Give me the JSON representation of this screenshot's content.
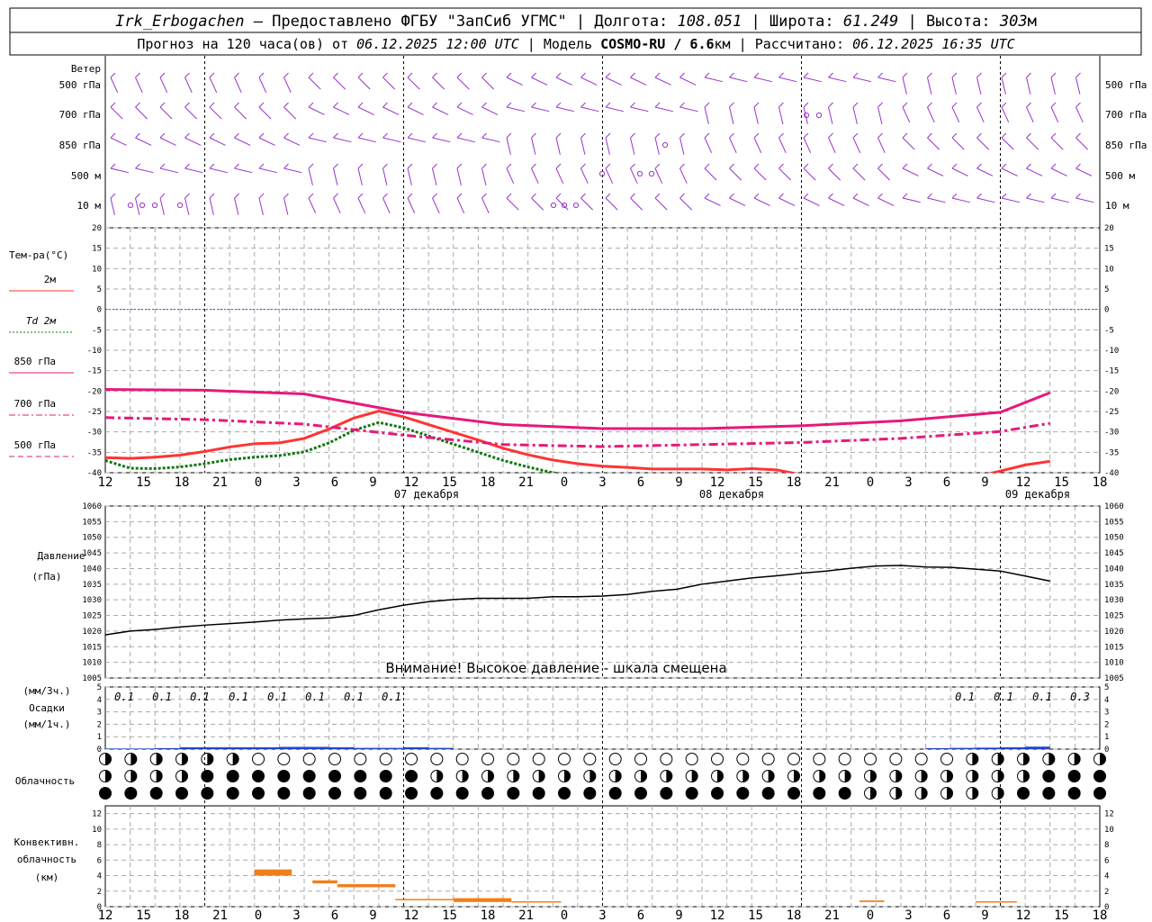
{
  "header": {
    "station": "Irk_Erbogachen",
    "provider": " – Предоставлено ФГБУ \"ЗапСиб УГМС\"",
    "lon_label": "Долгота:",
    "lon": "108.051",
    "lat_label": "Широта:",
    "lat": "61.249",
    "alt_label": "Высота:",
    "alt": "303",
    "alt_unit": "м",
    "forecast_prefix": "Прогноз на 120 часа(ов) от",
    "forecast_start": "06.12.2025 12:00 UTC",
    "model_label": "Модель",
    "model": "COSMO-RU / 6.6",
    "model_unit": "км",
    "calc_label": "Рассчитано:",
    "calc_time": "06.12.2025 16:35 UTC"
  },
  "wind_panel": {
    "title": "Ветер",
    "levels": [
      "500 гПа",
      "700 гПа",
      "850 гПа",
      "500 м",
      "10  м"
    ],
    "color": "#9933cc"
  },
  "temp_panel": {
    "title": "Тем-ра(°C)",
    "legend": [
      {
        "label": "2м",
        "color": "#ff3333",
        "style": "solid"
      },
      {
        "label": "Td  2м",
        "color": "#117711",
        "style": "dotted"
      },
      {
        "label": "850 гПа",
        "color": "#e6197a",
        "style": "solid"
      },
      {
        "label": "700 гПа",
        "color": "#e6197a",
        "style": "dashdot"
      },
      {
        "label": "500 гПа",
        "color": "#e6197a",
        "style": "dashed"
      }
    ]
  },
  "pressure_panel": {
    "title1": "Давление",
    "title2": "(гПа)",
    "warning": "Внимание! Высокое давление - шкала смещена"
  },
  "precip_panel": {
    "title1": "(мм/3ч.)",
    "title2": "Осадки",
    "title3": "(мм/1ч.)",
    "labels": [
      "0.1",
      "0.1",
      "0.1",
      "0.1",
      "0.1",
      "0.1",
      "0.1",
      "0.1",
      "0.1",
      "0.1",
      "0.1",
      "0.3"
    ]
  },
  "cloud_panel": {
    "title": "Облачность"
  },
  "conv_panel": {
    "title1": "Конвективн.",
    "title2": "облачность",
    "title3": "(км)",
    "color": "#f07f1d"
  },
  "x_axis": {
    "hour_labels": [
      "12",
      "15",
      "18",
      "21",
      "0",
      "3",
      "6",
      "9",
      "12",
      "15",
      "18",
      "21",
      "0",
      "3",
      "6",
      "9",
      "12",
      "15",
      "18",
      "21",
      "0",
      "3",
      "6",
      "9",
      "12",
      "15",
      "18"
    ],
    "days": [
      "07 декабря",
      "08 декабря",
      "09 декабря"
    ]
  },
  "chart_data": [
    {
      "type": "line",
      "title": "Тем-ра(°C)",
      "x_unit": "hours from 06.12.2025 12:00 UTC",
      "ylim": [
        -40,
        20
      ],
      "yticks": [
        20,
        15,
        10,
        5,
        0,
        -5,
        -10,
        -15,
        -20,
        -25,
        -30,
        -35,
        -40
      ],
      "series": [
        {
          "name": "2м",
          "x": [
            0,
            3,
            6,
            9,
            12,
            15,
            18,
            21,
            24,
            27,
            30,
            33,
            36,
            39,
            42,
            45,
            48,
            51,
            54,
            57,
            60,
            63,
            66,
            69,
            72,
            75,
            78,
            81,
            84,
            87,
            90,
            93,
            96,
            99,
            102,
            105,
            108,
            111,
            114
          ],
          "values": [
            -36.3,
            -36.5,
            -36.2,
            -35.7,
            -34.8,
            -33.7,
            -32.9,
            -32.7,
            -31.6,
            -29.3,
            -26.6,
            -24.9,
            -26.3,
            -28.2,
            -30.1,
            -32,
            -34,
            -35.6,
            -36.9,
            -37.8,
            -38.4,
            -38.7,
            -39.1,
            -39.1,
            -39.1,
            -39.3,
            -39,
            -39.3,
            -40.5,
            -41,
            -41.3,
            -41.5,
            -41.5,
            -41.6,
            -41.5,
            -41,
            -39.6,
            -38.1,
            -37.2
          ]
        },
        {
          "name": "Td  2м",
          "x": [
            0,
            3,
            6,
            9,
            12,
            15,
            18,
            21,
            24,
            27,
            30,
            33,
            36,
            39,
            42,
            45,
            48,
            51,
            54,
            57,
            60,
            63,
            66,
            69,
            72,
            75,
            78,
            81,
            84,
            87,
            90,
            93,
            96,
            99,
            102,
            105,
            108,
            111,
            114
          ],
          "values": [
            -37,
            -38.9,
            -39,
            -38.6,
            -37.8,
            -36.8,
            -36.2,
            -35.8,
            -34.9,
            -32.7,
            -29.6,
            -27.7,
            -29,
            -31,
            -33,
            -35,
            -37,
            -38.6,
            -40,
            -41,
            -41.6,
            -42,
            -42.4,
            -42.4,
            -42.6,
            -42.7,
            -42.4,
            -42.7,
            -43.5,
            -44,
            -44.3,
            -44.5,
            -44.6,
            -44.7,
            -44.7,
            -44.4,
            -43.3,
            -41.8,
            -40.6
          ]
        },
        {
          "name": "850 гПа",
          "x": [
            0,
            12,
            24,
            36,
            48,
            60,
            72,
            84,
            96,
            108,
            114
          ],
          "values": [
            -19.6,
            -19.8,
            -20.7,
            -25.2,
            -28.2,
            -29.2,
            -29.2,
            -28.5,
            -27.3,
            -25.2,
            -20.4
          ]
        },
        {
          "name": "700 гПа",
          "x": [
            0,
            12,
            24,
            36,
            48,
            60,
            72,
            84,
            96,
            108,
            114
          ],
          "values": [
            -26.5,
            -27,
            -28.1,
            -30.8,
            -33.1,
            -33.6,
            -33.1,
            -32.6,
            -31.6,
            -29.9,
            -27.9
          ]
        },
        {
          "name": "500 гПа",
          "x": [
            0,
            12,
            24,
            36,
            48,
            60,
            72,
            84,
            96,
            108,
            114
          ],
          "values": [
            -44,
            -44.5,
            -45.2,
            -46.5,
            -47.2,
            -47.5,
            -47.7,
            -47.5,
            -47.3,
            -47,
            -46.5
          ]
        }
      ]
    },
    {
      "type": "line",
      "title": "Давление",
      "ylabel": "(гПа)",
      "ylim": [
        1005,
        1060
      ],
      "yticks": [
        1060,
        1055,
        1050,
        1045,
        1040,
        1035,
        1030,
        1025,
        1020,
        1015,
        1010,
        1005
      ],
      "x": [
        0,
        3,
        6,
        9,
        12,
        15,
        18,
        21,
        24,
        27,
        30,
        33,
        36,
        39,
        42,
        45,
        48,
        51,
        54,
        57,
        60,
        63,
        66,
        69,
        72,
        75,
        78,
        81,
        84,
        87,
        90,
        93,
        96,
        99,
        102,
        105,
        108,
        111,
        114
      ],
      "values": [
        1018.8,
        1020,
        1020.5,
        1021.3,
        1021.9,
        1022.4,
        1022.9,
        1023.5,
        1023.9,
        1024.2,
        1025,
        1026.8,
        1028.3,
        1029.4,
        1030.1,
        1030.5,
        1030.5,
        1030.5,
        1031,
        1031,
        1031.2,
        1031.7,
        1032.7,
        1033.4,
        1035,
        1036,
        1037,
        1037.7,
        1038.5,
        1039.2,
        1040.1,
        1040.8,
        1041,
        1040.5,
        1040.4,
        1039.8,
        1039.2,
        1037.6,
        1036
      ]
    },
    {
      "type": "bar",
      "title": "Осадки",
      "ylabel": "(мм/1ч.)",
      "ylim": [
        0,
        5
      ],
      "yticks": [
        5,
        4,
        3,
        2,
        1,
        0
      ],
      "x": [
        3,
        6,
        9,
        12,
        15,
        18,
        21,
        24,
        27,
        30,
        33,
        36,
        39,
        42,
        45,
        48,
        51,
        54,
        57,
        60,
        63,
        66,
        69,
        72,
        75,
        78,
        81,
        84,
        87,
        90,
        93,
        96,
        99,
        102,
        105,
        108,
        111,
        114
      ],
      "values": [
        0.05,
        0.05,
        0.08,
        0.15,
        0.15,
        0.15,
        0.15,
        0.18,
        0.18,
        0.15,
        0.1,
        0.1,
        0.15,
        0.1,
        0,
        0,
        0,
        0,
        0,
        0,
        0,
        0,
        0,
        0,
        0,
        0,
        0,
        0,
        0,
        0,
        0,
        0,
        0,
        0.08,
        0.1,
        0.12,
        0.15,
        0.2
      ]
    },
    {
      "type": "bar",
      "title": "Конвективн. облачность",
      "ylabel": "(км)",
      "ylim": [
        0,
        13
      ],
      "yticks": [
        12,
        10,
        8,
        6,
        4,
        2,
        0
      ],
      "bars": [
        {
          "x0": 18,
          "x1": 22.5,
          "bottom": 4,
          "top": 4.8
        },
        {
          "x0": 25,
          "x1": 28,
          "bottom": 3,
          "top": 3.4
        },
        {
          "x0": 28,
          "x1": 35,
          "bottom": 2.5,
          "top": 2.9
        },
        {
          "x0": 35,
          "x1": 42,
          "bottom": 0.9,
          "top": 1
        },
        {
          "x0": 42,
          "x1": 49,
          "bottom": 0.6,
          "top": 1.1
        },
        {
          "x0": 49,
          "x1": 55,
          "bottom": 0.6,
          "top": 0.7
        },
        {
          "x0": 91,
          "x1": 94,
          "bottom": 0.6,
          "top": 0.8
        },
        {
          "x0": 105,
          "x1": 110,
          "bottom": 0.6,
          "top": 0.7
        },
        {
          "x0": 148,
          "x1": 154,
          "bottom": 0.6,
          "top": 0.7
        }
      ]
    }
  ]
}
